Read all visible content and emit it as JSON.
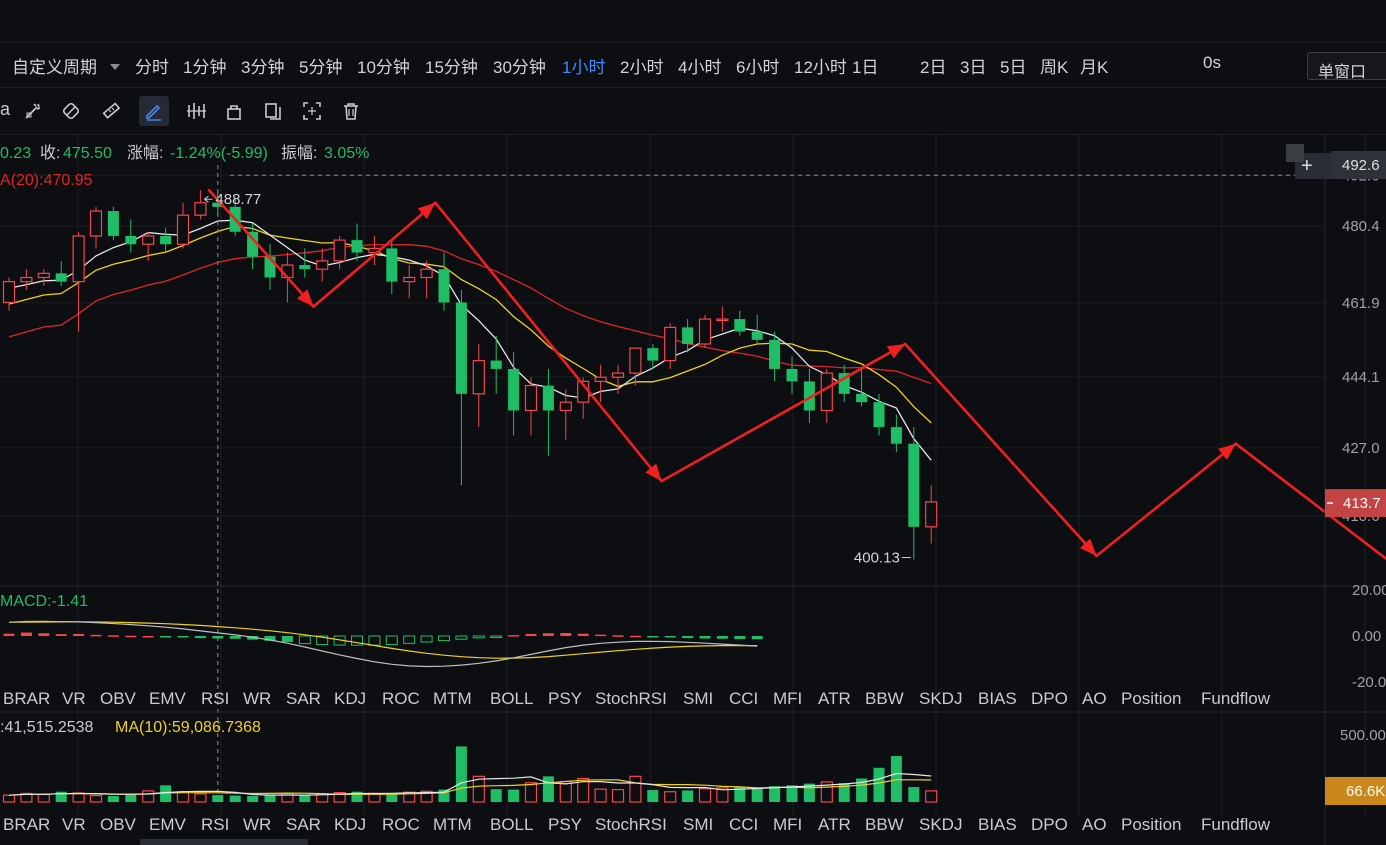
{
  "toolbar_periods": {
    "custom_label": "自定义周期",
    "items": [
      "分时",
      "1分钟",
      "3分钟",
      "5分钟",
      "10分钟",
      "15分钟",
      "30分钟",
      "1小时",
      "2小时",
      "4小时",
      "6小时",
      "12小时",
      "1日",
      "2日",
      "3日",
      "5日",
      "周K",
      "月K"
    ],
    "active": "1小时",
    "countdown": "0s",
    "window_mode": "单窗口"
  },
  "tool_icons": [
    "magic-draw-icon",
    "ruler-pencil-icon",
    "eraser-icon",
    "measure-icon",
    "pencil-draw-icon",
    "indicator-icon",
    "lock-icon",
    "copy-icon",
    "screenshot-icon",
    "trash-icon"
  ],
  "info_line": {
    "open_partial": "0.23",
    "close_label": "收:",
    "close_value": "475.50",
    "change_label": "涨幅:",
    "change_value": "-1.24%(-5.99)",
    "amplitude_label": "振幅:",
    "amplitude_value": "3.05%"
  },
  "ma_label": "A(20):470.95",
  "macd_label": "MACD:-1.41",
  "volume_label": ":41,515.2538",
  "volume_ma_label": "MA(10):59,086.7368",
  "indicator_tabs": [
    "BRAR",
    "VR",
    "OBV",
    "EMV",
    "RSI",
    "WR",
    "SAR",
    "KDJ",
    "ROC",
    "MTM",
    "BOLL",
    "PSY",
    "StochRSI",
    "SMI",
    "CCI",
    "MFI",
    "ATR",
    "BBW",
    "SKDJ",
    "BIAS",
    "DPO",
    "AO",
    "Position",
    "Fundflow"
  ],
  "colors": {
    "up": "#f2474d",
    "down": "#1fbd66",
    "ma_white": "#e6e6e6",
    "ma_yellow": "#f0d020",
    "ma_red": "#e02525",
    "arrow": "#f02020",
    "active_blue": "#3d8bfd",
    "price_tag_bg": "#c34444",
    "volume_tag_bg": "#c9871c"
  },
  "chart_data": {
    "type": "candlestick",
    "y_axis_ticks": [
      "492.6",
      "480.4",
      "461.9",
      "444.1",
      "427.0",
      "410.6"
    ],
    "ylim": [
      394,
      497
    ],
    "current_price": "413.7",
    "current_price_value": 413.7,
    "crosshair_price": "492.6",
    "annotations": {
      "high_label": "488.77",
      "high_value": 488.77,
      "low_label": "400.13",
      "low_value": 400.13
    },
    "candles": [
      [
        462,
        468,
        460,
        467
      ],
      [
        467,
        470,
        465,
        468
      ],
      [
        468,
        470,
        466,
        469
      ],
      [
        469,
        472,
        466,
        467
      ],
      [
        467,
        479,
        455,
        478
      ],
      [
        478,
        485,
        475,
        484
      ],
      [
        484,
        485,
        477,
        478
      ],
      [
        478,
        482,
        474,
        476
      ],
      [
        476,
        479,
        472,
        478
      ],
      [
        478,
        480,
        474,
        476
      ],
      [
        476,
        486,
        475,
        483
      ],
      [
        483,
        489,
        482,
        486
      ],
      [
        486,
        489,
        483,
        485
      ],
      [
        485,
        487,
        478,
        479
      ],
      [
        479,
        481,
        470,
        473
      ],
      [
        473,
        476,
        465,
        468
      ],
      [
        468,
        474,
        462,
        471
      ],
      [
        471,
        475,
        468,
        470
      ],
      [
        470,
        475,
        467,
        472
      ],
      [
        472,
        478,
        470,
        477
      ],
      [
        477,
        481,
        472,
        474
      ],
      [
        474,
        478,
        471,
        475
      ],
      [
        475,
        477,
        464,
        467
      ],
      [
        467,
        471,
        463,
        468
      ],
      [
        468,
        472,
        463,
        470
      ],
      [
        470,
        474,
        460,
        462
      ],
      [
        462,
        465,
        418,
        440
      ],
      [
        440,
        452,
        432,
        448
      ],
      [
        448,
        454,
        440,
        446
      ],
      [
        446,
        450,
        430,
        436
      ],
      [
        436,
        444,
        430,
        442
      ],
      [
        442,
        446,
        425,
        436
      ],
      [
        436,
        441,
        429,
        438
      ],
      [
        438,
        444,
        434,
        443
      ],
      [
        443,
        447,
        438,
        444
      ],
      [
        444,
        447,
        440,
        445
      ],
      [
        445,
        451,
        442,
        451
      ],
      [
        451,
        452,
        446,
        448
      ],
      [
        448,
        457,
        446,
        456
      ],
      [
        456,
        458,
        450,
        452
      ],
      [
        452,
        459,
        451,
        458
      ],
      [
        458,
        461,
        455,
        458
      ],
      [
        458,
        460,
        454,
        455
      ],
      [
        455,
        459,
        452,
        453
      ],
      [
        453,
        455,
        443,
        446
      ],
      [
        446,
        449,
        440,
        443
      ],
      [
        443,
        446,
        433,
        436
      ],
      [
        436,
        446,
        433,
        445
      ],
      [
        445,
        447,
        438,
        440
      ],
      [
        440,
        446,
        437,
        438
      ],
      [
        438,
        440,
        430,
        432
      ],
      [
        432,
        435,
        426,
        428
      ],
      [
        428,
        432,
        400.13,
        408
      ],
      [
        408,
        418,
        404,
        414
      ]
    ],
    "macd": [
      1.0,
      1.5,
      1.2,
      0.8,
      0.9,
      0.5,
      0.3,
      0.1,
      0.0,
      -0.3,
      -0.6,
      -0.9,
      -1.1,
      -1.2,
      -1.6,
      -2.1,
      -2.6,
      -3.3,
      -3.7,
      -3.9,
      -4.0,
      -4.0,
      -3.7,
      -3.2,
      -2.6,
      -2.0,
      -1.4,
      -0.8,
      -0.2,
      0.4,
      0.9,
      1.2,
      1.3,
      1.0,
      0.6,
      0.3,
      0.1,
      -0.3,
      -0.6,
      -0.9,
      -1.1,
      -1.2,
      -1.3,
      -1.41
    ],
    "macd_ylim": [
      -20,
      20
    ],
    "macd_ticks": [
      "20.00",
      "0.00",
      "-20.00"
    ],
    "volume_ticks": [
      "500.00",
      "66.6K"
    ],
    "volumes": [
      32,
      40,
      36,
      48,
      42,
      30,
      28,
      34,
      52,
      78,
      48,
      38,
      32,
      30,
      28,
      34,
      40,
      30,
      36,
      44,
      48,
      40,
      36,
      46,
      50,
      58,
      260,
      120,
      60,
      58,
      90,
      120,
      96,
      110,
      60,
      58,
      120,
      56,
      48,
      54,
      62,
      66,
      70,
      64,
      74,
      78,
      86,
      94,
      88,
      110,
      160,
      215,
      70,
      52
    ],
    "trend_arrows": [
      {
        "from": [
          12,
          489
        ],
        "to": [
          18,
          461
        ]
      },
      {
        "from": [
          18,
          461
        ],
        "to": [
          25,
          486
        ]
      },
      {
        "from": [
          25,
          486
        ],
        "to": [
          38,
          419
        ]
      },
      {
        "from": [
          38,
          419
        ],
        "to": [
          52,
          452
        ]
      },
      {
        "from": [
          52,
          452
        ],
        "to": [
          63,
          401
        ]
      },
      {
        "from": [
          63,
          401
        ],
        "to": [
          71,
          428
        ]
      },
      {
        "from": [
          71,
          428
        ],
        "to": [
          81,
          396
        ]
      }
    ]
  }
}
